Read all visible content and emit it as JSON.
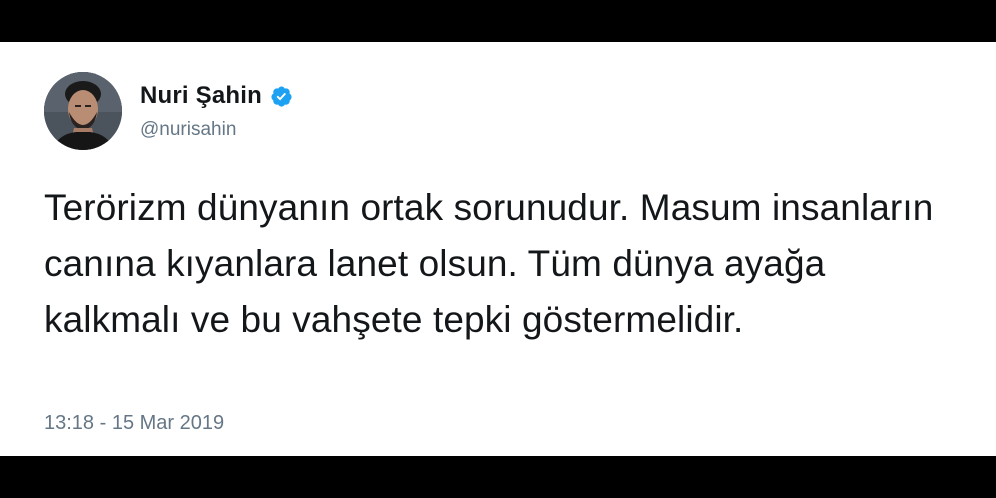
{
  "tweet": {
    "author": {
      "display_name": "Nuri Şahin",
      "handle": "@nurisahin",
      "verified": true,
      "avatar_icon": "user-avatar-photo"
    },
    "text": "Terörizm dünyanın ortak sorunudur. Masum insanların canına kıyanlara lanet olsun. Tüm dünya ayağa kalkmalı ve bu vahşete tepki göstermelidir.",
    "timestamp": "13:18 - 15 Mar 2019"
  },
  "colors": {
    "background": "#000000",
    "card": "#ffffff",
    "text_primary": "#14171a",
    "text_secondary": "#657786",
    "verified_badge": "#1da1f2"
  }
}
